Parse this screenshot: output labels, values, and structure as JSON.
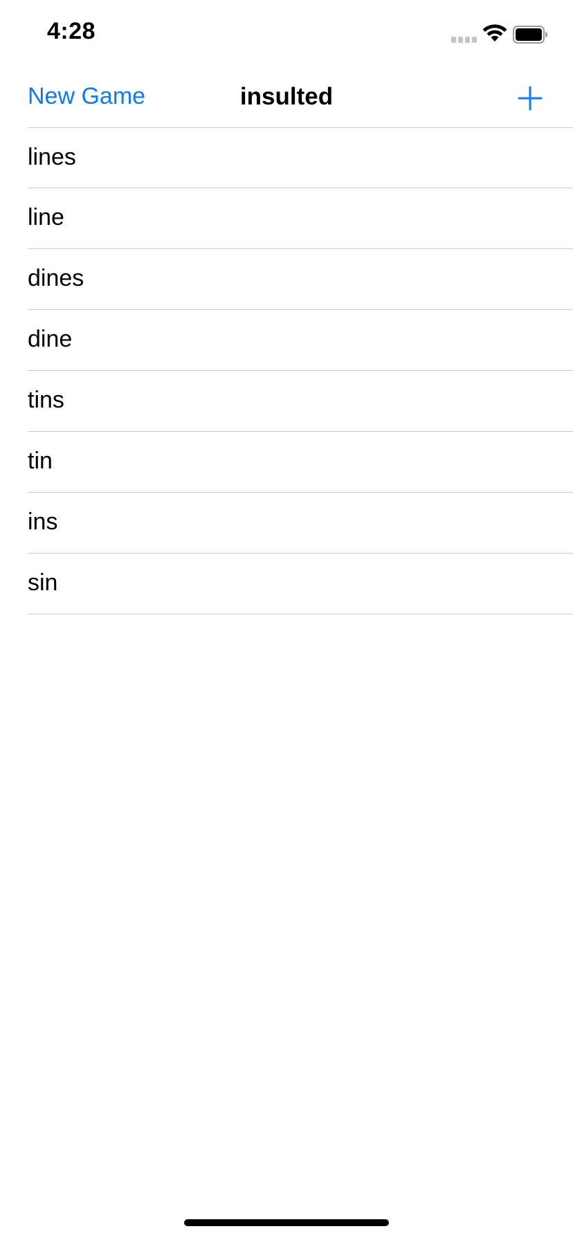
{
  "status_bar": {
    "time": "4:28"
  },
  "nav": {
    "left_button": "New Game",
    "title": "insulted",
    "right_icon": "plus-icon"
  },
  "colors": {
    "accent": "#0a7aff",
    "separator": "#c8c8cc"
  },
  "words": [
    "lines",
    "line",
    "dines",
    "dine",
    "tins",
    "tin",
    "ins",
    "sin"
  ]
}
